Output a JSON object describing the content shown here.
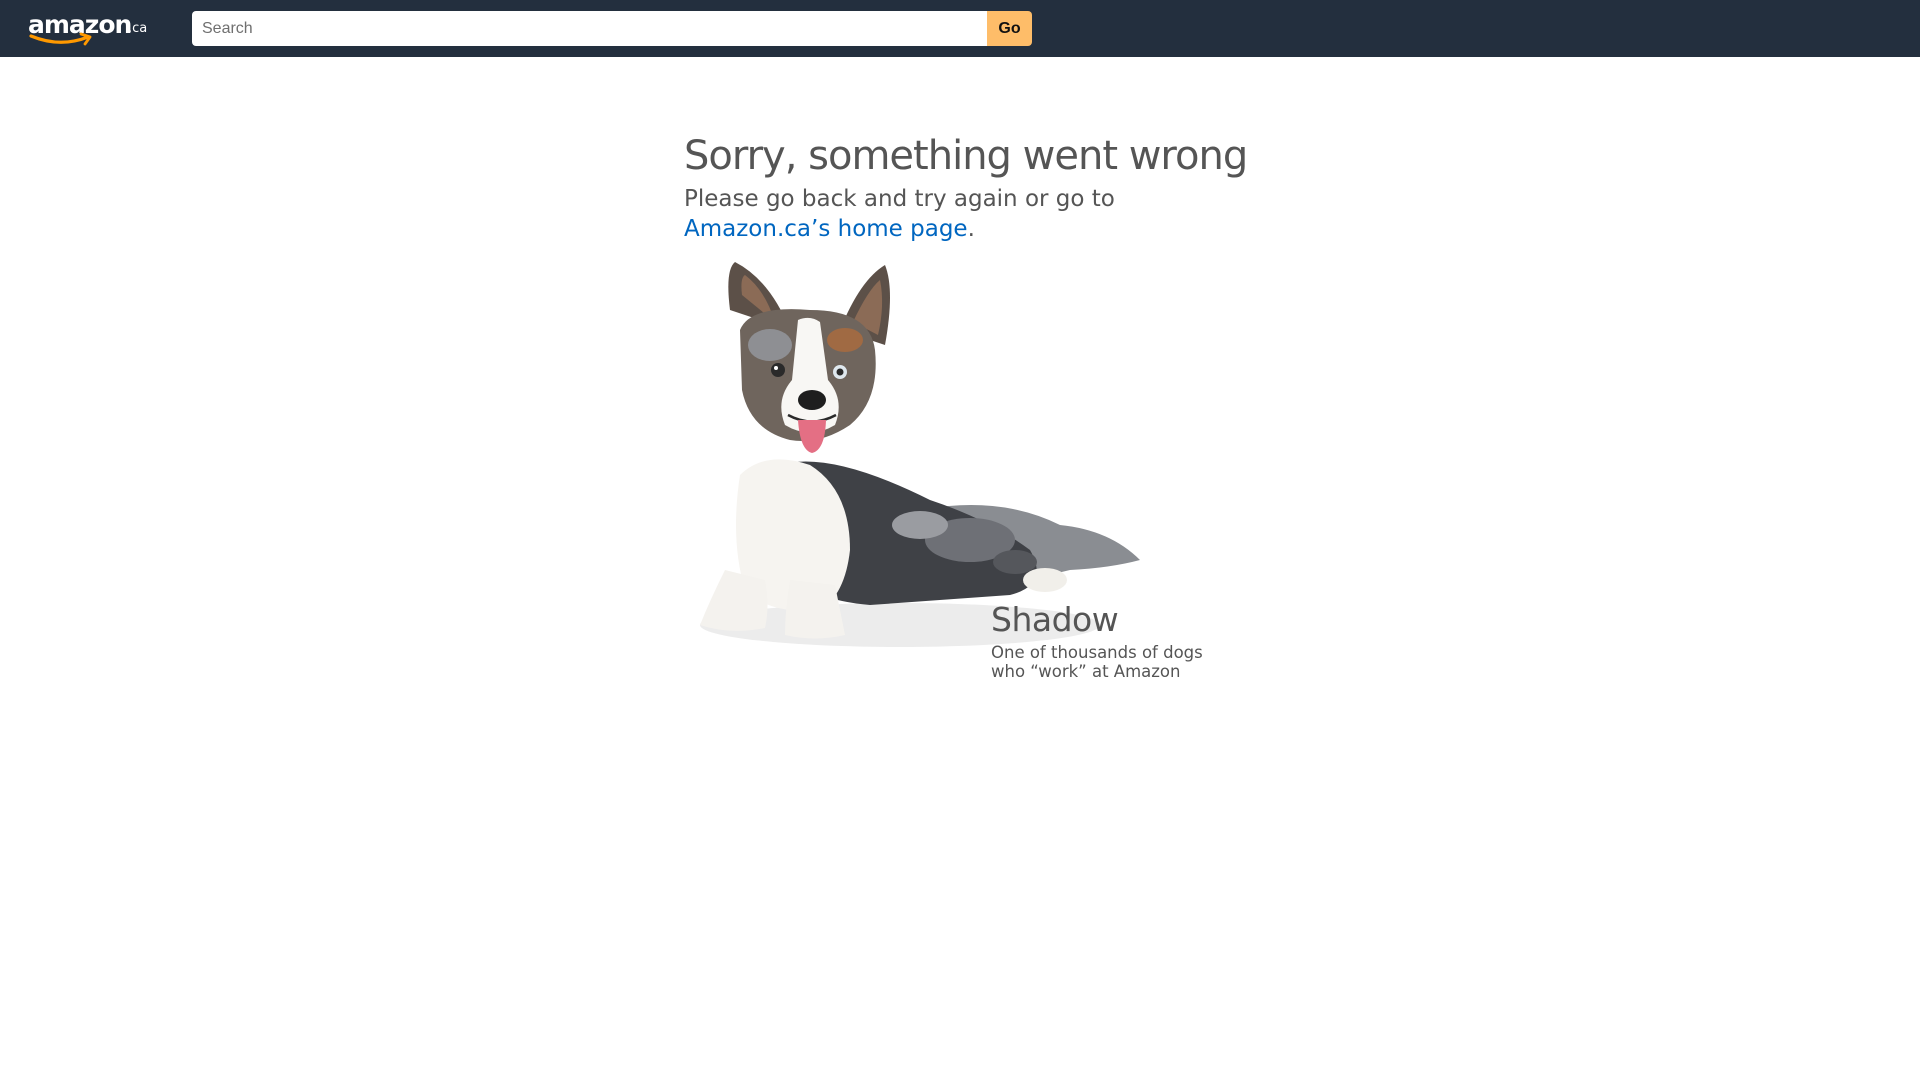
{
  "header": {
    "logo_text": "amazon",
    "logo_tld": ".ca",
    "search_placeholder": "Search",
    "search_value": "",
    "go_label": "Go"
  },
  "error": {
    "title": "Sorry, something went wrong",
    "subtitle": "Please go back and try again or go to",
    "home_link": "Amazon.ca’s home page",
    "period": "."
  },
  "dog": {
    "name": "Shadow",
    "caption_line1": "One of thousands of dogs",
    "caption_line2": "who “work” at Amazon"
  },
  "colors": {
    "header_bg": "#232f3e",
    "go_button": "#febd69",
    "link": "#0066c0",
    "text_gray": "#555555",
    "logo_smile": "#ff9900"
  },
  "icons": {
    "logo": "amazon-smile-logo",
    "dog": "corgi-dog-illustration"
  }
}
